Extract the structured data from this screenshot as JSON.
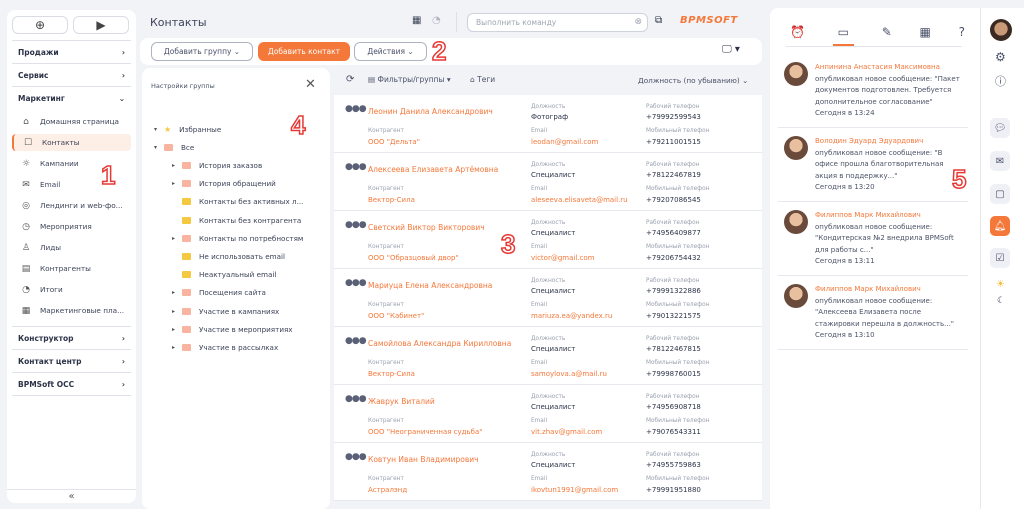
{
  "nav": {
    "sections_top": [
      {
        "label": "Продажи"
      },
      {
        "label": "Сервис"
      },
      {
        "label": "Маркетинг"
      }
    ],
    "items": [
      {
        "label": "Домашняя страница",
        "icon": "⌂"
      },
      {
        "label": "Контакты",
        "icon": "☐"
      },
      {
        "label": "Кампании",
        "icon": "☼"
      },
      {
        "label": "Email",
        "icon": "✉"
      },
      {
        "label": "Лендинги и web-фо...",
        "icon": "◎"
      },
      {
        "label": "Мероприятия",
        "icon": "◷"
      },
      {
        "label": "Лиды",
        "icon": "♙"
      },
      {
        "label": "Контрагенты",
        "icon": "▤"
      },
      {
        "label": "Итоги",
        "icon": "◔"
      },
      {
        "label": "Маркетинговые пла...",
        "icon": "▦"
      }
    ],
    "sections_bottom": [
      {
        "label": "Конструктор"
      },
      {
        "label": "Контакт центр"
      },
      {
        "label": "BPMSoft OCC"
      }
    ],
    "collapse": "«"
  },
  "header": {
    "title": "Контакты",
    "command_placeholder": "Выполнить команду",
    "logo": "BPMSOFT"
  },
  "toolbar": {
    "add_group": "Добавить группу",
    "add_contact": "Добавить контакт",
    "actions": "Действия"
  },
  "filters": {
    "filters_groups": "Фильтры/группы",
    "tags": "Теги",
    "sort": "Должность (по убыванию)"
  },
  "groups": {
    "title": "Настройки группы",
    "items": [
      {
        "label": "Избранные",
        "level": 0,
        "kind": "star",
        "exp": "▾"
      },
      {
        "label": "Все",
        "level": 0,
        "kind": "f",
        "exp": "▾"
      },
      {
        "label": "История заказов",
        "level": 1,
        "kind": "f",
        "exp": "▸"
      },
      {
        "label": "История обращений",
        "level": 1,
        "kind": "f",
        "exp": "▸"
      },
      {
        "label": "Контакты без активных л...",
        "level": 1,
        "kind": "y",
        "exp": ""
      },
      {
        "label": "Контакты без контрагента",
        "level": 1,
        "kind": "y",
        "exp": ""
      },
      {
        "label": "Контакты по потребностям",
        "level": 1,
        "kind": "f",
        "exp": "▸"
      },
      {
        "label": "Не использовать email",
        "level": 1,
        "kind": "y",
        "exp": ""
      },
      {
        "label": "Неактуальный email",
        "level": 1,
        "kind": "y",
        "exp": ""
      },
      {
        "label": "Посещения сайта",
        "level": 1,
        "kind": "f",
        "exp": "▸"
      },
      {
        "label": "Участие в кампаниях",
        "level": 1,
        "kind": "f",
        "exp": "▸"
      },
      {
        "label": "Участие в мероприятиях",
        "level": 1,
        "kind": "f",
        "exp": "▸"
      },
      {
        "label": "Участие в рассылках",
        "level": 1,
        "kind": "f",
        "exp": "▸"
      }
    ]
  },
  "labels": {
    "org": "Контрагент",
    "job": "Должность",
    "email": "Email",
    "work": "Рабочий телефон",
    "mobile": "Мобильный телефон"
  },
  "contacts": [
    {
      "name": "Леонин Данила Александрович",
      "org": "ООО \"Дельта\"",
      "job": "Фотограф",
      "email": "leodan@gmail.com",
      "work": "+79992599543",
      "mobile": "+79211001515"
    },
    {
      "name": "Алексеева Елизавета Артёмовна",
      "org": "Вектор-Сила",
      "job": "Специалист",
      "email": "aleseeva.elisaveta@mail.ru",
      "work": "+78122467819",
      "mobile": "+79207086545"
    },
    {
      "name": "Светский Виктор Викторович",
      "org": "ООО \"Образцовый двор\"",
      "job": "Специалист",
      "email": "victor@gmail.com",
      "work": "+74956409877",
      "mobile": "+79206754432"
    },
    {
      "name": "Мариуца Елена Александровна",
      "org": "ООО \"Кабинет\"",
      "job": "Специалист",
      "email": "mariuza.ea@yandex.ru",
      "work": "+79991322886",
      "mobile": "+79013221575"
    },
    {
      "name": "Самойлова Александра Кирилловна",
      "org": "Вектор-Сила",
      "job": "Специалист",
      "email": "samoylova.a@mail.ru",
      "work": "+78122467815",
      "mobile": "+79998760015"
    },
    {
      "name": "Жаврук Виталий",
      "org": "ООО \"Неограниченная судьба\"",
      "job": "Специалист",
      "email": "vit.zhav@gmail.com",
      "work": "+74956908718",
      "mobile": "+79076543311"
    },
    {
      "name": "Ковтун Иван Владимирович",
      "org": "Астралэнд",
      "job": "Специалист",
      "email": "ikovtun1991@gmail.com",
      "work": "+74955759863",
      "mobile": "+79991951880"
    }
  ],
  "notifications": [
    {
      "who": "Анпинина Анастасия Максимовна",
      "text": "опубликовал новое сообщение: \"Пакет документов подготовлен. Требуется дополнительное согласование\"",
      "time": "Сегодня в 13:24"
    },
    {
      "who": "Володин Эдуард Эдуардович",
      "text": "опубликовал новое сообщение: \"В офисе прошла благотворительная акция в поддержку...\"",
      "time": "Сегодня в 13:20"
    },
    {
      "who": "Филиппов Марк Михайлович",
      "text": "опубликовал новое сообщение: \"Кондитерская №2 внедрила BPMSoft для работы с...\"",
      "time": "Сегодня в 13:11"
    },
    {
      "who": "Филиппов Марк Михайлович",
      "text": "опубликовал новое сообщение: \"Алексеева Елизавета после стажировки перешла в должность...\"",
      "time": "Сегодня в 13:10"
    }
  ],
  "annotations": [
    "1",
    "2",
    "3",
    "4",
    "5"
  ],
  "colors": {
    "accent": "#f4783a",
    "bg": "#f2f3f7"
  }
}
